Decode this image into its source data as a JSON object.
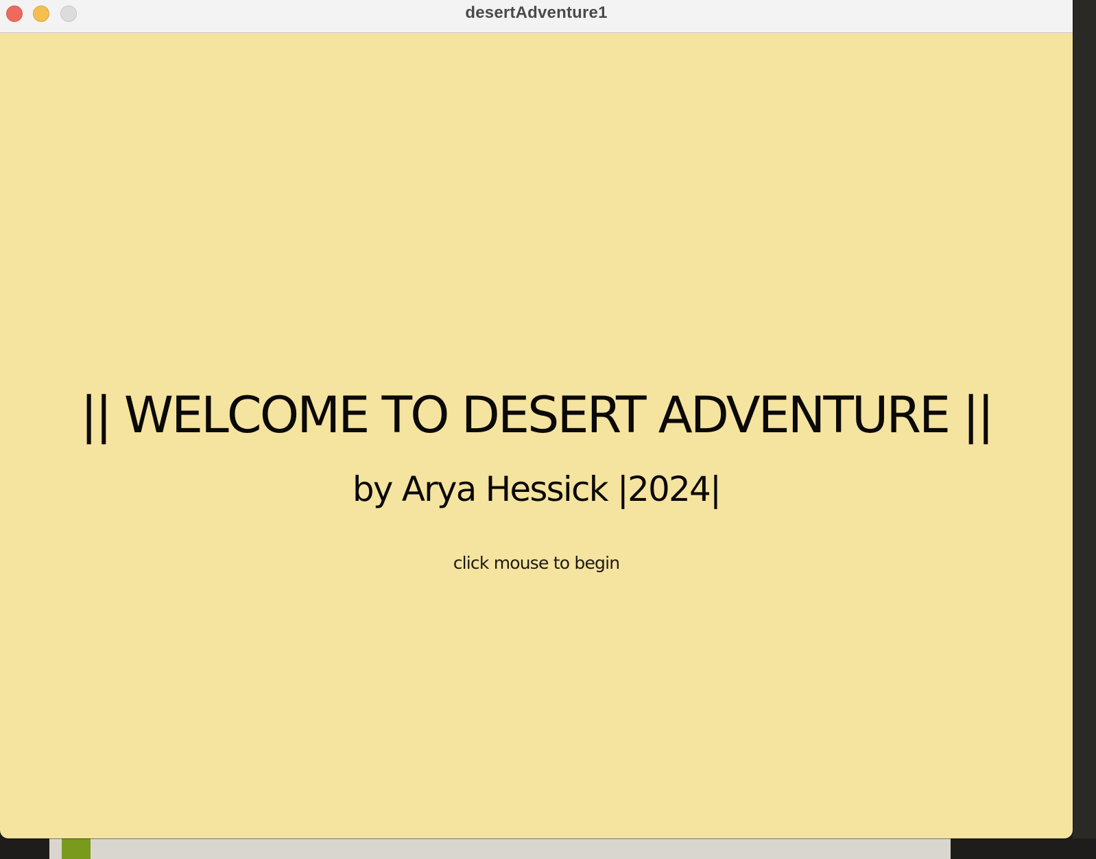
{
  "window": {
    "title": "desertAdventure1"
  },
  "titlebar": {
    "buttons": [
      "close",
      "minimize",
      "maximize"
    ]
  },
  "canvas": {
    "background": "#f5e3a0",
    "text_color": "#0a0906",
    "headline": "|| WELCOME TO DESERT ADVENTURE ||",
    "byline": "by Arya Hessick |2024|",
    "prompt": "click mouse to begin"
  },
  "colors": {
    "close": "#ee6a5f",
    "minimize": "#f5bf4f",
    "maximize": "#dcdcdc"
  }
}
